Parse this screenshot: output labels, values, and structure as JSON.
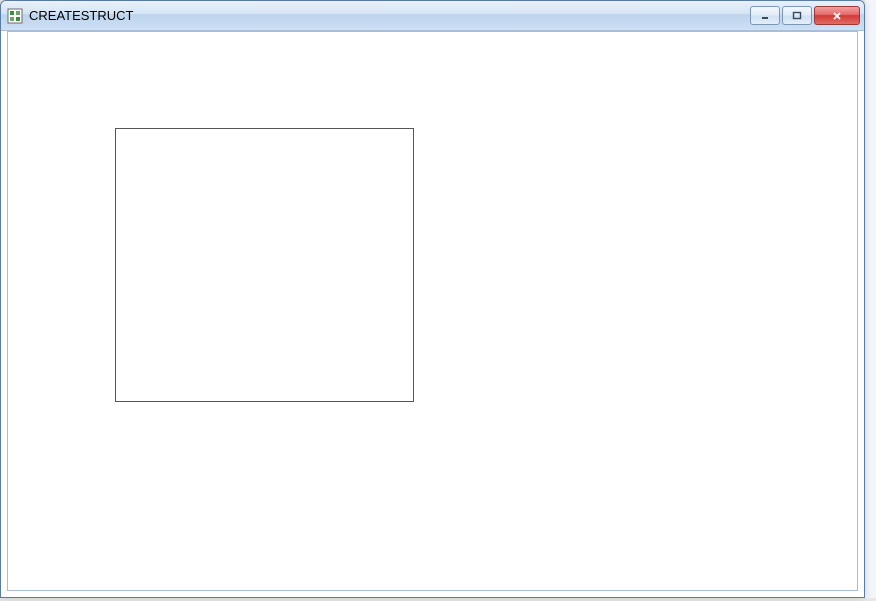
{
  "window": {
    "title": "CREATESTRUCT"
  }
}
